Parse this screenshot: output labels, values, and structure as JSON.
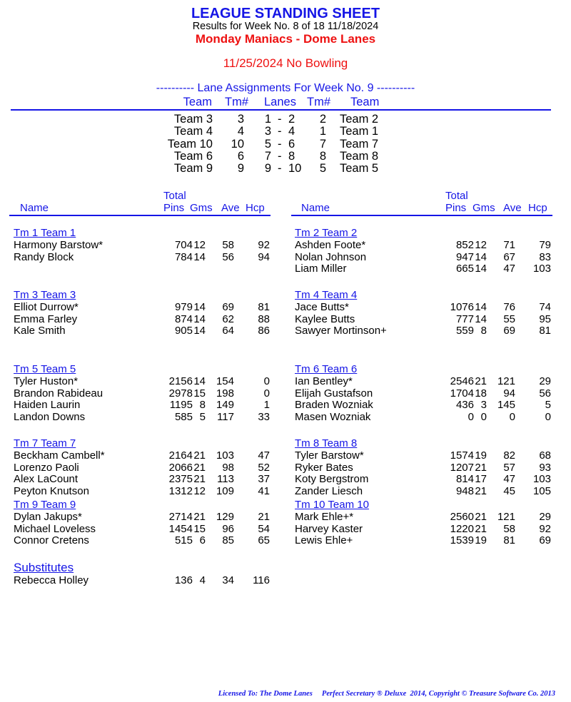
{
  "header": {
    "title": "LEAGUE STANDING SHEET",
    "subtitle": "Results for Week No. 8 of 18    11/18/2024",
    "league_name": "Monday Maniacs - Dome Lanes",
    "notice": "11/25/2024  No Bowling"
  },
  "lane_assignments": {
    "title": "---------- Lane Assignments For Week No. 9 ----------",
    "headers": {
      "team_a": "Team",
      "tm_a": "Tm#",
      "lanes": "Lanes",
      "tm_b": "Tm#",
      "team_b": "Team"
    },
    "rows": [
      {
        "team_a": "Team 3",
        "tm_a": "3",
        "lane_a": "1",
        "lane_b": "2",
        "tm_b": "2",
        "team_b": "Team 2"
      },
      {
        "team_a": "Team 4",
        "tm_a": "4",
        "lane_a": "3",
        "lane_b": "4",
        "tm_b": "1",
        "team_b": "Team 1"
      },
      {
        "team_a": "Team 10",
        "tm_a": "10",
        "lane_a": "5",
        "lane_b": "6",
        "tm_b": "7",
        "team_b": "Team 7"
      },
      {
        "team_a": "Team 6",
        "tm_a": "6",
        "lane_a": "7",
        "lane_b": "8",
        "tm_b": "8",
        "team_b": "Team 8"
      },
      {
        "team_a": "Team 9",
        "tm_a": "9",
        "lane_a": "9",
        "lane_b": "10",
        "tm_b": "5",
        "team_b": "Team 5"
      }
    ]
  },
  "standings_headers": {
    "name": "Name",
    "total": "Total",
    "pins": "Pins",
    "gms": "Gms",
    "ave": "Ave",
    "hcp": "Hcp"
  },
  "left_column": [
    {
      "heading": "Tm 1 Team 1",
      "players": [
        {
          "name": "Harmony Barstow*",
          "pins": "704",
          "gms": "12",
          "ave": "58",
          "hcp": "92"
        },
        {
          "name": "Randy Block",
          "pins": "784",
          "gms": "14",
          "ave": "56",
          "hcp": "94"
        }
      ]
    },
    {
      "heading": "Tm 3 Team 3",
      "players": [
        {
          "name": "Elliot Durrow*",
          "pins": "979",
          "gms": "14",
          "ave": "69",
          "hcp": "81"
        },
        {
          "name": "Emma Farley",
          "pins": "874",
          "gms": "14",
          "ave": "62",
          "hcp": "88"
        },
        {
          "name": "Kale Smith",
          "pins": "905",
          "gms": "14",
          "ave": "64",
          "hcp": "86"
        }
      ]
    },
    {
      "heading": "Tm 5 Team 5",
      "players": [
        {
          "name": "Tyler Huston*",
          "pins": "2156",
          "gms": "14",
          "ave": "154",
          "hcp": "0"
        },
        {
          "name": "Brandon Rabideau",
          "pins": "2978",
          "gms": "15",
          "ave": "198",
          "hcp": "0"
        },
        {
          "name": "Haiden Laurin",
          "pins": "1195",
          "gms": "8",
          "ave": "149",
          "hcp": "1"
        },
        {
          "name": "Landon Downs",
          "pins": "585",
          "gms": "5",
          "ave": "117",
          "hcp": "33"
        }
      ]
    },
    {
      "heading": "Tm 7 Team 7",
      "players": [
        {
          "name": "Beckham Cambell*",
          "pins": "2164",
          "gms": "21",
          "ave": "103",
          "hcp": "47"
        },
        {
          "name": "Lorenzo Paoli",
          "pins": "2066",
          "gms": "21",
          "ave": "98",
          "hcp": "52"
        },
        {
          "name": "Alex LaCount",
          "pins": "2375",
          "gms": "21",
          "ave": "113",
          "hcp": "37"
        },
        {
          "name": "Peyton Knutson",
          "pins": "1312",
          "gms": "12",
          "ave": "109",
          "hcp": "41"
        }
      ]
    },
    {
      "heading": "Tm 9 Team 9",
      "players": [
        {
          "name": "Dylan Jakups*",
          "pins": "2714",
          "gms": "21",
          "ave": "129",
          "hcp": "21"
        },
        {
          "name": "Michael Loveless",
          "pins": "1454",
          "gms": "15",
          "ave": "96",
          "hcp": "54"
        },
        {
          "name": "Connor Cretens",
          "pins": "515",
          "gms": "6",
          "ave": "85",
          "hcp": "65"
        }
      ]
    },
    {
      "heading": "Substitutes",
      "subs": true,
      "players": [
        {
          "name": "Rebecca Holley",
          "pins": "136",
          "gms": "4",
          "ave": "34",
          "hcp": "116"
        }
      ]
    }
  ],
  "right_column": [
    {
      "heading": "Tm 2 Team 2",
      "players": [
        {
          "name": "Ashden Foote*",
          "pins": "852",
          "gms": "12",
          "ave": "71",
          "hcp": "79"
        },
        {
          "name": "Nolan Johnson",
          "pins": "947",
          "gms": "14",
          "ave": "67",
          "hcp": "83"
        },
        {
          "name": "Liam Miller",
          "pins": "665",
          "gms": "14",
          "ave": "47",
          "hcp": "103"
        }
      ]
    },
    {
      "heading": "Tm 4 Team 4",
      "players": [
        {
          "name": "Jace Butts*",
          "pins": "1076",
          "gms": "14",
          "ave": "76",
          "hcp": "74"
        },
        {
          "name": "Kaylee Butts",
          "pins": "777",
          "gms": "14",
          "ave": "55",
          "hcp": "95"
        },
        {
          "name": "Sawyer Mortinson+",
          "pins": "559",
          "gms": "8",
          "ave": "69",
          "hcp": "81"
        }
      ]
    },
    {
      "heading": "Tm 6 Team 6",
      "players": [
        {
          "name": "Ian Bentley*",
          "pins": "2546",
          "gms": "21",
          "ave": "121",
          "hcp": "29"
        },
        {
          "name": "Elijah Gustafson",
          "pins": "1704",
          "gms": "18",
          "ave": "94",
          "hcp": "56"
        },
        {
          "name": "Braden Wozniak",
          "pins": "436",
          "gms": "3",
          "ave": "145",
          "hcp": "5"
        },
        {
          "name": "Masen Wozniak",
          "pins": "0",
          "gms": "0",
          "ave": "0",
          "hcp": "0"
        }
      ]
    },
    {
      "heading": "Tm 8 Team 8",
      "players": [
        {
          "name": "Tyler Barstow*",
          "pins": "1574",
          "gms": "19",
          "ave": "82",
          "hcp": "68"
        },
        {
          "name": "Ryker Bates",
          "pins": "1207",
          "gms": "21",
          "ave": "57",
          "hcp": "93"
        },
        {
          "name": "Koty Bergstrom",
          "pins": "814",
          "gms": "17",
          "ave": "47",
          "hcp": "103"
        },
        {
          "name": "Zander Liesch",
          "pins": "948",
          "gms": "21",
          "ave": "45",
          "hcp": "105"
        }
      ]
    },
    {
      "heading": "Tm 10 Team 10",
      "players": [
        {
          "name": "Mark Ehle+*",
          "pins": "2560",
          "gms": "21",
          "ave": "121",
          "hcp": "29"
        },
        {
          "name": "Harvey Kaster",
          "pins": "1220",
          "gms": "21",
          "ave": "58",
          "hcp": "92"
        },
        {
          "name": "Lewis Ehle+",
          "pins": "1539",
          "gms": "19",
          "ave": "81",
          "hcp": "69"
        }
      ]
    }
  ],
  "footer": {
    "text": "Licensed To: The Dome Lanes     Perfect Secretary ® Deluxe  2014, Copyright © Treasure Software Co. 2013"
  }
}
